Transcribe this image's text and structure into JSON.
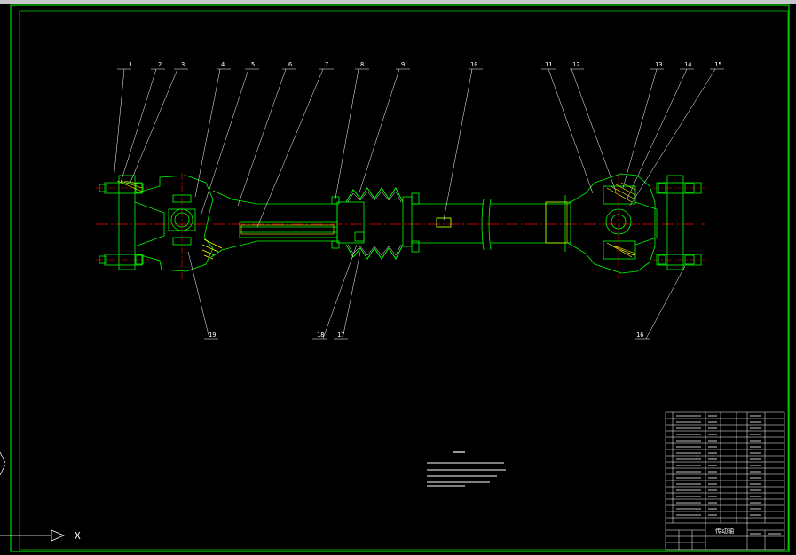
{
  "drawing": {
    "background": "#000000",
    "frame_color": "#00ff00",
    "part_color": "#00ff00",
    "centerline_color": "#ff0000",
    "leader_color": "#ffffff",
    "accent_yellow": "#ffff00",
    "title_block_label": "传动轴"
  },
  "callouts": [
    {
      "label": "1"
    },
    {
      "label": "2"
    },
    {
      "label": "3"
    },
    {
      "label": "4"
    },
    {
      "label": "5"
    },
    {
      "label": "6"
    },
    {
      "label": "7"
    },
    {
      "label": "8"
    },
    {
      "label": "9"
    },
    {
      "label": "10"
    },
    {
      "label": "11"
    },
    {
      "label": "12"
    },
    {
      "label": "13"
    },
    {
      "label": "14"
    },
    {
      "label": "15"
    },
    {
      "label": "16"
    },
    {
      "label": "17"
    },
    {
      "label": "18"
    },
    {
      "label": "19"
    }
  ],
  "ucs": {
    "x_label": "X"
  }
}
